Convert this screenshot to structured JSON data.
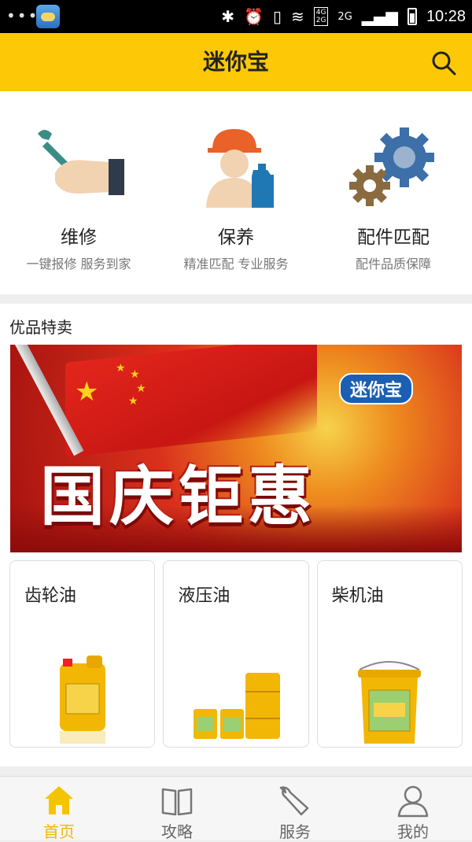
{
  "status_bar": {
    "time": "10:28",
    "net1": "4G",
    "net2": "2G",
    "net3": "2G"
  },
  "header": {
    "title": "迷你宝",
    "search_icon": "search-icon",
    "accent_color": "#fdc806"
  },
  "services": [
    {
      "icon": "wrench-hand-icon",
      "name": "维修",
      "subtitle": "一键报修 服务到家"
    },
    {
      "icon": "worker-oil-icon",
      "name": "保养",
      "subtitle": "精准匹配 专业服务"
    },
    {
      "icon": "gears-icon",
      "name": "配件匹配",
      "subtitle": "配件品质保障"
    }
  ],
  "featured": {
    "section_title": "优品特卖",
    "banner": {
      "logo_text": "迷你宝",
      "headline": "国庆钜惠"
    },
    "products": [
      {
        "name": "齿轮油",
        "image": "gear-oil-jug"
      },
      {
        "name": "液压油",
        "image": "hydraulic-oil-drums"
      },
      {
        "name": "柴机油",
        "image": "diesel-oil-bucket"
      }
    ]
  },
  "tab_bar": {
    "tabs": [
      {
        "label": "首页",
        "icon": "home-icon",
        "active": true
      },
      {
        "label": "攻略",
        "icon": "book-icon",
        "active": false
      },
      {
        "label": "服务",
        "icon": "wrench-icon",
        "active": false
      },
      {
        "label": "我的",
        "icon": "user-icon",
        "active": false
      }
    ],
    "active_color": "#f0b800"
  }
}
